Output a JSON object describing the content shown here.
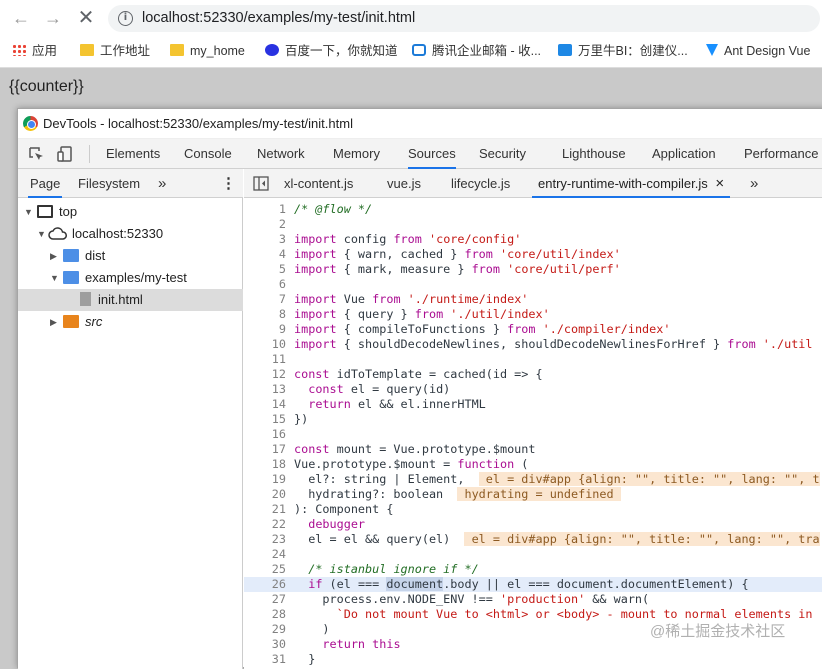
{
  "browser": {
    "url": "localhost:52330/examples/my-test/init.html",
    "bookmarks": [
      {
        "label": "应用",
        "icon": "apps-grid-icon"
      },
      {
        "label": "工作地址",
        "icon": "folder-icon"
      },
      {
        "label": "my_home",
        "icon": "folder-icon"
      },
      {
        "label": "百度一下，你就知道",
        "icon": "baidu-paw-icon"
      },
      {
        "label": "腾讯企业邮箱 - 收...",
        "icon": "tencent-mail-icon"
      },
      {
        "label": "万里牛BI：创建仪...",
        "icon": "wanliniu-icon"
      },
      {
        "label": "Ant Design Vue",
        "icon": "antd-icon"
      }
    ]
  },
  "page": {
    "text": "{{counter}}"
  },
  "devtools": {
    "title": "DevTools - localhost:52330/examples/my-test/init.html",
    "tabs": [
      "Elements",
      "Console",
      "Network",
      "Memory",
      "Sources",
      "Security",
      "Lighthouse",
      "Application",
      "Performance"
    ],
    "active_tab": "Sources",
    "navigator": {
      "tabs": [
        "Page",
        "Filesystem"
      ],
      "more": "»",
      "menu": "⋮",
      "tree": [
        {
          "label": "top"
        },
        {
          "label": "localhost:52330"
        },
        {
          "label": "dist"
        },
        {
          "label": "examples/my-test"
        },
        {
          "label": "init.html"
        },
        {
          "label": "src"
        }
      ]
    },
    "editor": {
      "tabs": [
        "xl-content.js",
        "vue.js",
        "lifecycle.js",
        "entry-runtime-with-compiler.js"
      ],
      "close": "×",
      "more": "»"
    }
  },
  "watermark": "@稀土掘金技术社区"
}
